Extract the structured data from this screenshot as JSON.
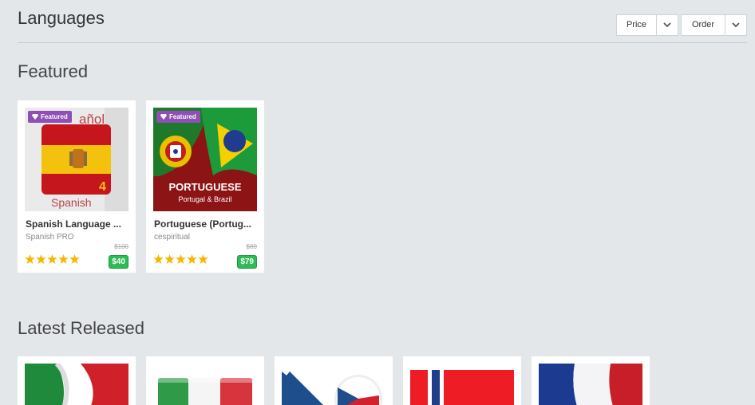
{
  "header": {
    "title": "Languages",
    "sort_price_label": "Price",
    "sort_order_label": "Order"
  },
  "featured": {
    "title": "Featured",
    "badge_label": "Featured",
    "items": [
      {
        "name": "Spanish Language ...",
        "author": "Spanish PRO",
        "old_price": "$100",
        "price": "$40",
        "rating": 5,
        "thumb_word_top": "añol",
        "thumb_word_bottom": "Spanish",
        "thumb_number": "4"
      },
      {
        "name": "Portuguese (Portug...",
        "author": "cespiritual",
        "old_price": "$89",
        "price": "$79",
        "rating": 5,
        "thumb_title": "PORTUGUESE",
        "thumb_subtitle": "Portugal & Brazil"
      }
    ]
  },
  "latest": {
    "title": "Latest Released",
    "items": [
      {
        "flag": "italy-flag-waving"
      },
      {
        "flag": "italy-flag"
      },
      {
        "flag": "czech-flag"
      },
      {
        "flag": "norway-flag"
      },
      {
        "flag": "france-flag-waving"
      }
    ]
  },
  "colors": {
    "background": "#e4e7ea",
    "featured_badge": "#8f4fb6",
    "price_badge": "#2dbb55",
    "star": "#f5b800"
  }
}
